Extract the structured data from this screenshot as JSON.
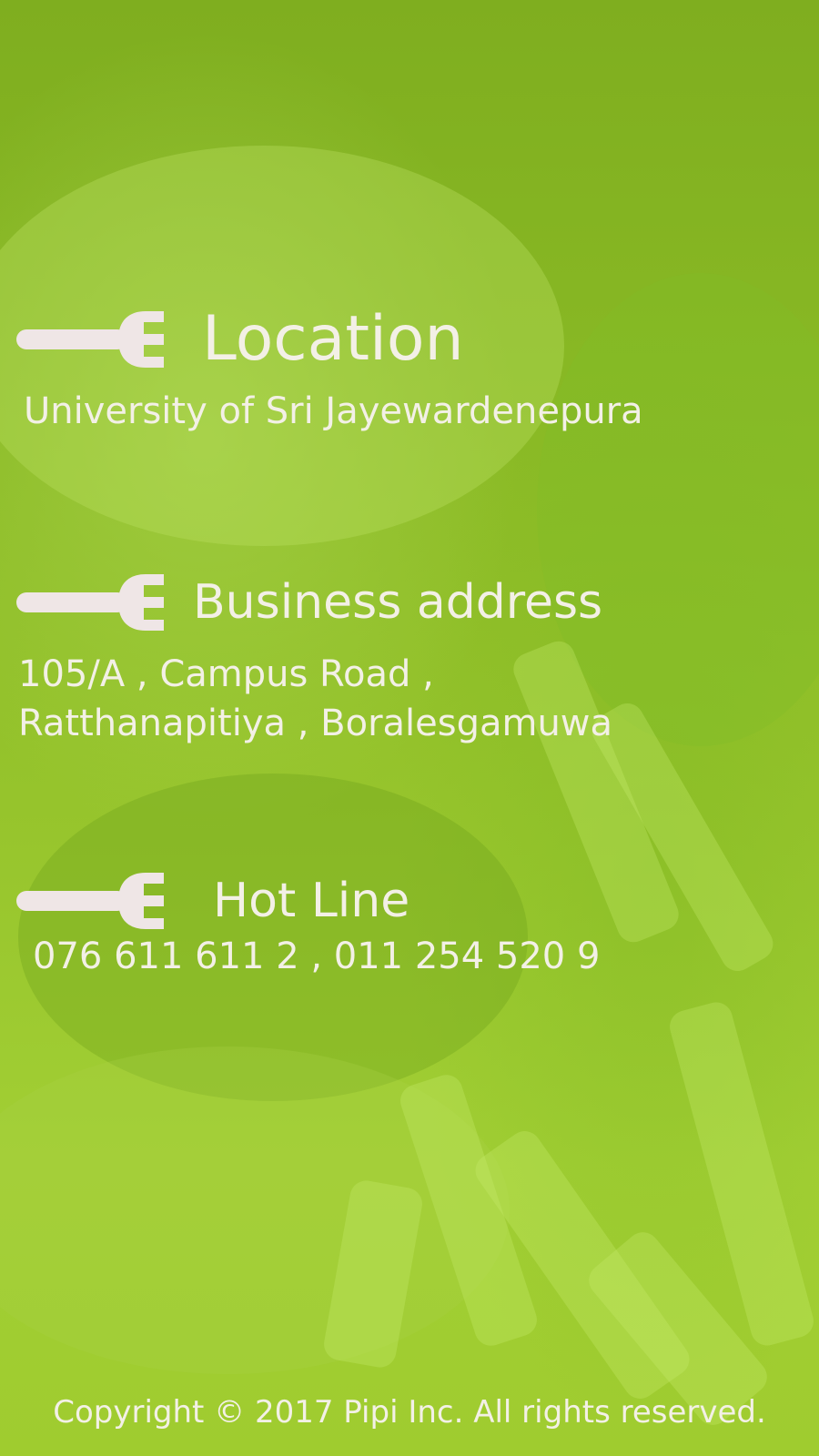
{
  "sections": [
    {
      "icon": "fork-icon",
      "title": "Location",
      "lines": [
        "University of Sri Jayewardenepura"
      ]
    },
    {
      "icon": "fork-icon",
      "title": "Business address",
      "lines": [
        "105/A , Campus Road ,",
        "Ratthanapitiya , Boralesgamuwa"
      ]
    },
    {
      "icon": "fork-icon",
      "title": "Hot Line",
      "lines": [
        "076 611 611 2 , 011 254 520 9"
      ]
    }
  ],
  "footer": {
    "copyright": "Copyright © 2017 Pipi Inc. All rights reserved."
  },
  "colors": {
    "background": "#8fc02a",
    "text": "#f3f0e6"
  }
}
